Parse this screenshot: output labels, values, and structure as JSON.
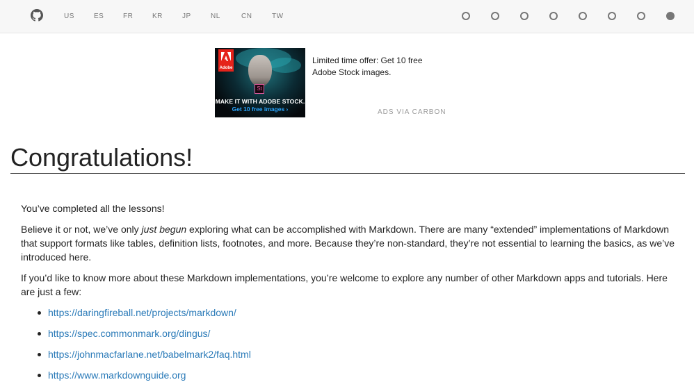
{
  "nav": {
    "languages": [
      "US",
      "ES",
      "FR",
      "KR",
      "JP",
      "NL",
      "CN",
      "TW"
    ],
    "lesson_dots": [
      {
        "active": false
      },
      {
        "active": false
      },
      {
        "active": false
      },
      {
        "active": false
      },
      {
        "active": false
      },
      {
        "active": false
      },
      {
        "active": false
      },
      {
        "active": true
      }
    ]
  },
  "ad": {
    "image_brand": "Adobe",
    "image_badge": "St",
    "image_line1": "MAKE IT WITH ADOBE STOCK.",
    "image_line2": "Get 10 free images ›",
    "text": "Limited time offer: Get 10 free Adobe Stock images.",
    "via": "ADS VIA CARBON"
  },
  "page": {
    "title": "Congratulations!",
    "p1": "You’ve completed all the lessons!",
    "p2_before": "Believe it or not, we’ve only ",
    "p2_em": "just begun",
    "p2_after": " exploring what can be accomplished with Markdown. There are many “extended” implementations of Markdown that support formats like tables, definition lists, footnotes, and more. Because they’re non-standard, they’re not essential to learning the basics, as we’ve introduced here.",
    "p3": "If you’d like to know more about these Markdown implementations, you’re welcome to explore any number of other Markdown apps and tutorials. Here are just a few:",
    "links": [
      "https://daringfireball.net/projects/markdown/",
      "https://spec.commonmark.org/dingus/",
      "https://johnmacfarlane.net/babelmark2/faq.html",
      "https://www.markdownguide.org"
    ]
  },
  "colors": {
    "link": "#2a7ab8",
    "topbar_bg": "#f7f7f7",
    "dot": "#777777"
  }
}
